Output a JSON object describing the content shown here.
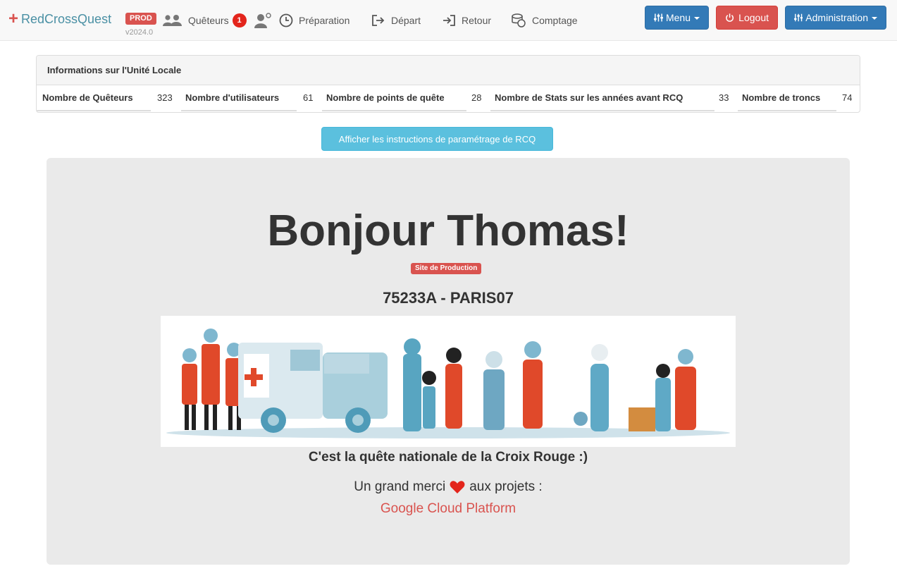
{
  "brand": {
    "name": "RedCrossQuest",
    "env": "PROD",
    "version": "v2024.0"
  },
  "nav": {
    "queteurs_label": "Quêteurs",
    "queteurs_count": "1",
    "preparation_label": "Préparation",
    "depart_label": "Départ",
    "retour_label": "Retour",
    "comptage_label": "Comptage",
    "menu_label": "Menu",
    "logout_label": "Logout",
    "admin_label": "Administration"
  },
  "panel": {
    "title": "Informations sur l'Unité Locale",
    "stats": [
      {
        "label": "Nombre de Quêteurs",
        "value": "323"
      },
      {
        "label": "Nombre d'utilisateurs",
        "value": "61"
      },
      {
        "label": "Nombre de points de quête",
        "value": "28"
      },
      {
        "label": "Nombre de Stats sur les années avant RCQ",
        "value": "33"
      },
      {
        "label": "Nombre de troncs",
        "value": "74"
      }
    ]
  },
  "setup_button": "Afficher les instructions de paramétrage de RCQ",
  "welcome": {
    "greeting": "Bonjour Thomas!",
    "site_badge": "Site de Production",
    "unit": "75233A - PARIS07",
    "tagline": "C'est la quête nationale de la Croix Rouge :)",
    "thanks_before": "Un grand merci",
    "thanks_after": "aux projets :",
    "project": "Google Cloud Platform"
  },
  "colors": {
    "brand_red": "#d9534f",
    "primary_blue": "#337ab7",
    "info_blue": "#5bc0de",
    "heart_red": "#e3251c"
  }
}
